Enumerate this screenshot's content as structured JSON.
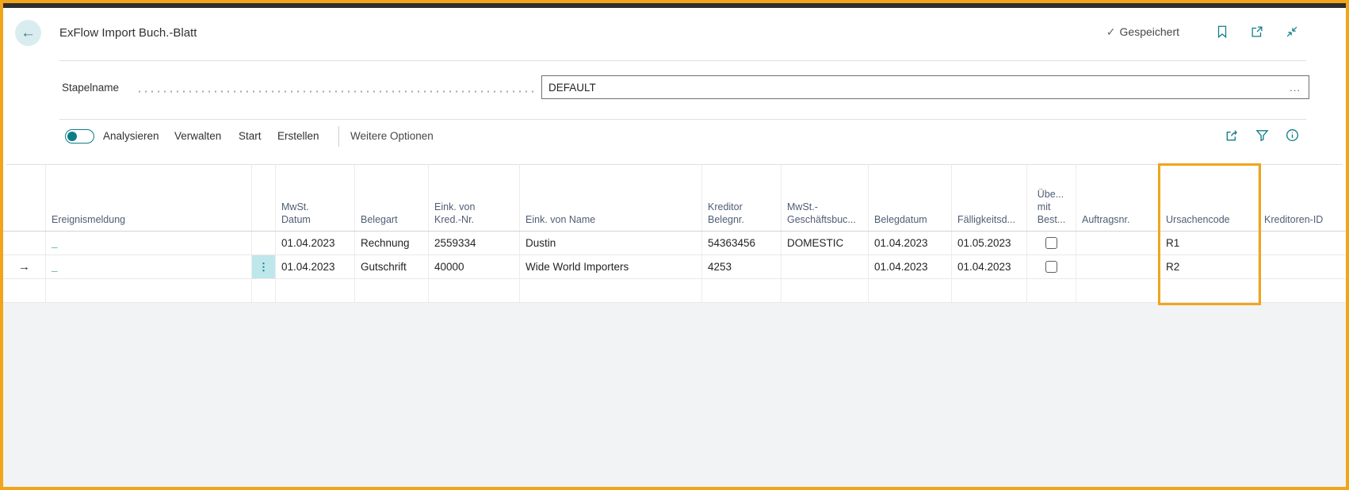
{
  "colors": {
    "accent_teal": "#0E7C86",
    "highlight_orange": "#F0A51B",
    "topbar_dark": "#2E2E2E",
    "menu_cell_cyan": "#BDE7EB",
    "back_circle": "#D9EDF0",
    "footer_gray": "#F2F3F5"
  },
  "icons": {
    "back_arrow": "←",
    "saved_check": "✓",
    "row_pointer": "→",
    "menu_dots": "⋮",
    "ellipsis": "..."
  },
  "header": {
    "title": "ExFlow Import Buch.-Blatt",
    "saved_label": "Gespeichert"
  },
  "form": {
    "batch_label": "Stapelname",
    "batch_value": "DEFAULT"
  },
  "toolbar": {
    "items": [
      "Analysieren",
      "Verwalten",
      "Start",
      "Erstellen"
    ],
    "more_label": "Weitere Optionen"
  },
  "table": {
    "columns": [
      {
        "id": "ereignismeldung",
        "label": "Ereignismeldung"
      },
      {
        "id": "mwst_datum",
        "label": "MwSt.\nDatum"
      },
      {
        "id": "belegart",
        "label": "Belegart"
      },
      {
        "id": "eink_von_kred_nr",
        "label": "Eink. von\nKred.-Nr."
      },
      {
        "id": "eink_von_name",
        "label": "Eink. von Name"
      },
      {
        "id": "kreditor_belegnr",
        "label": "Kreditor\nBelegnr."
      },
      {
        "id": "mwst_geschaeftsbuc",
        "label": "MwSt.-\nGeschäftsbuc..."
      },
      {
        "id": "belegdatum",
        "label": "Belegdatum"
      },
      {
        "id": "faelligkeitsd",
        "label": "Fälligkeitsd..."
      },
      {
        "id": "ueb_mit_best",
        "label": "Übe...\nmit\nBest..."
      },
      {
        "id": "auftragsnr",
        "label": "Auftragsnr."
      },
      {
        "id": "ursachencode",
        "label": "Ursachencode"
      },
      {
        "id": "kreditoren_id",
        "label": "Kreditoren-ID"
      }
    ],
    "rows": [
      {
        "ereignismeldung": "_",
        "mwst_datum": "01.04.2023",
        "belegart": "Rechnung",
        "eink_von_kred_nr": "2559334",
        "eink_von_name": "Dustin",
        "kreditor_belegnr": "54363456",
        "mwst_geschaeftsbuc": "DOMESTIC",
        "belegdatum": "01.04.2023",
        "faelligkeitsd": "01.05.2023",
        "ueb_mit_best_checked": false,
        "auftragsnr": "",
        "ursachencode": "R1",
        "kreditoren_id": ""
      },
      {
        "ereignismeldung": "_",
        "mwst_datum": "01.04.2023",
        "belegart": "Gutschrift",
        "eink_von_kred_nr": "40000",
        "eink_von_name": "Wide World Importers",
        "kreditor_belegnr": "4253",
        "mwst_geschaeftsbuc": "",
        "belegdatum": "01.04.2023",
        "faelligkeitsd": "01.04.2023",
        "ueb_mit_best_checked": false,
        "auftragsnr": "",
        "ursachencode": "R2",
        "kreditoren_id": ""
      },
      {
        "ereignismeldung": "",
        "mwst_datum": "",
        "belegart": "",
        "eink_von_kred_nr": "",
        "eink_von_name": "",
        "kreditor_belegnr": "",
        "mwst_geschaeftsbuc": "",
        "belegdatum": "",
        "faelligkeitsd": "",
        "auftragsnr": "",
        "ursachencode": "",
        "kreditoren_id": ""
      }
    ]
  },
  "highlight": {
    "target_column": "Ursachencode"
  }
}
